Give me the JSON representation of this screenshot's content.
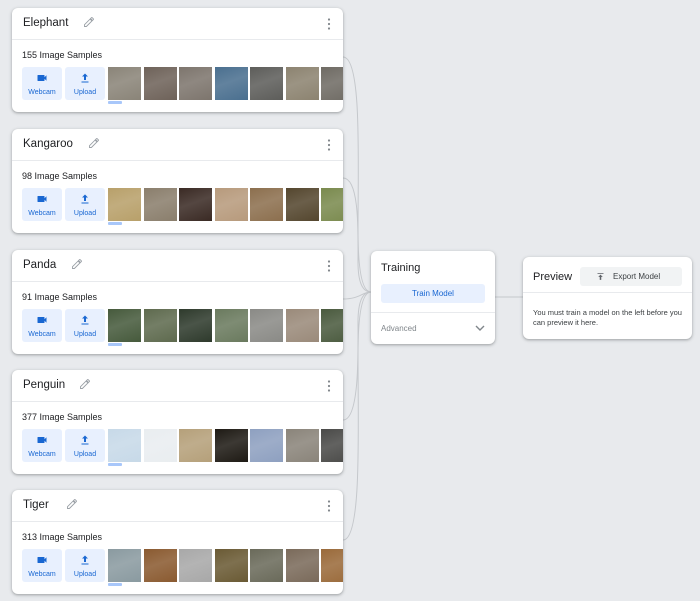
{
  "classes": [
    {
      "name": "Elephant",
      "samples": "155 Image Samples",
      "webcam_label": "Webcam",
      "upload_label": "Upload",
      "thumb_colors": [
        "#8a8478",
        "#6e6259",
        "#7d756d",
        "#4a6f8f",
        "#5d5d5a",
        "#8c8370",
        "#6f6b64",
        "#9a9386"
      ]
    },
    {
      "name": "Kangaroo",
      "samples": "98 Image Samples",
      "webcam_label": "Webcam",
      "upload_label": "Upload",
      "thumb_colors": [
        "#b8a06a",
        "#8a7e6c",
        "#3a2a24",
        "#b79a7c",
        "#8c6f4e",
        "#54462e",
        "#7a8a4e",
        "#a9a196"
      ]
    },
    {
      "name": "Panda",
      "samples": "91 Image Samples",
      "webcam_label": "Webcam",
      "upload_label": "Upload",
      "thumb_colors": [
        "#465a3c",
        "#5e6a4e",
        "#2e3a2c",
        "#6a7a5e",
        "#8a8a86",
        "#9a8a7a",
        "#4a5a3e",
        "#7a8a6e"
      ]
    },
    {
      "name": "Penguin",
      "samples": "377 Image Samples",
      "webcam_label": "Webcam",
      "upload_label": "Upload",
      "thumb_colors": [
        "#c7d9e8",
        "#e9edf0",
        "#b5a07a",
        "#1e1a14",
        "#8ea0c0",
        "#8a847a",
        "#4a4a48",
        "#8e9ea8"
      ]
    },
    {
      "name": "Tiger",
      "samples": "313 Image Samples",
      "webcam_label": "Webcam",
      "upload_label": "Upload",
      "thumb_colors": [
        "#8a9aa0",
        "#8a5a30",
        "#a8a8a8",
        "#6a5a34",
        "#6a6a5a",
        "#7a6a5a",
        "#9a6a3a",
        "#6a7a4a"
      ]
    }
  ],
  "training": {
    "title": "Training",
    "train_label": "Train Model",
    "advanced_label": "Advanced"
  },
  "preview": {
    "title": "Preview",
    "export_label": "Export Model",
    "message": "You must train a model on the left before you can preview it here."
  },
  "icons": {
    "edit": "pencil-icon",
    "more": "more-vert-icon",
    "webcam": "video-camera-icon",
    "upload": "upload-icon",
    "advanced": "chevron-down-icon",
    "export": "export-icon"
  },
  "colors": {
    "accent": "#1967d2",
    "accent_bg": "#e8f0fe",
    "background": "#e8eaed",
    "card": "#ffffff"
  }
}
